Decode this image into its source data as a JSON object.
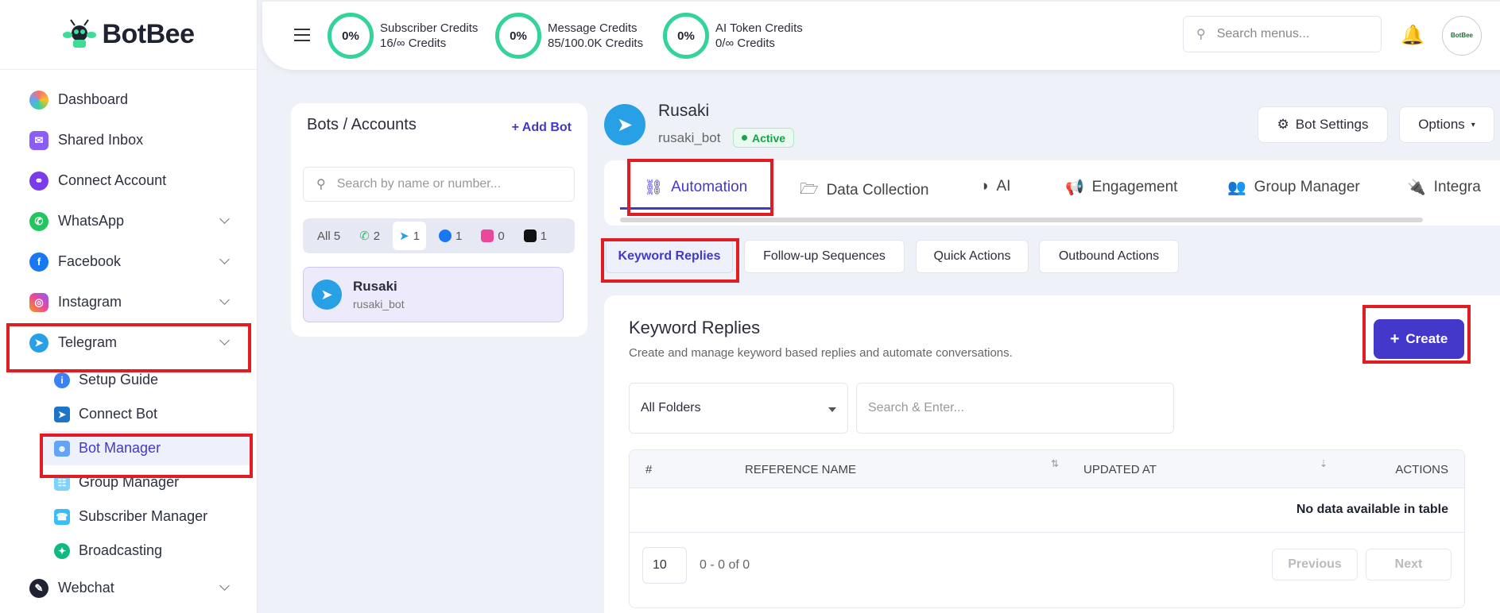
{
  "brand": {
    "name": "BotBee"
  },
  "sidebar": {
    "items": [
      {
        "label": "Dashboard",
        "icon": "dashboard-icon"
      },
      {
        "label": "Shared Inbox",
        "icon": "inbox-icon"
      },
      {
        "label": "Connect Account",
        "icon": "connect-icon"
      },
      {
        "label": "WhatsApp",
        "icon": "whatsapp-icon"
      },
      {
        "label": "Facebook",
        "icon": "facebook-icon"
      },
      {
        "label": "Instagram",
        "icon": "instagram-icon"
      },
      {
        "label": "Telegram",
        "icon": "telegram-icon"
      },
      {
        "label": "Webchat",
        "icon": "webchat-icon"
      }
    ],
    "telegram_sub": [
      {
        "label": "Setup Guide"
      },
      {
        "label": "Connect Bot"
      },
      {
        "label": "Bot Manager"
      },
      {
        "label": "Group Manager"
      },
      {
        "label": "Subscriber Manager"
      },
      {
        "label": "Broadcasting"
      }
    ]
  },
  "topbar": {
    "credits": [
      {
        "percent": "0%",
        "title": "Subscriber Credits",
        "value": "16/∞ Credits"
      },
      {
        "percent": "0%",
        "title": "Message Credits",
        "value": "85/100.0K Credits"
      },
      {
        "percent": "0%",
        "title": "AI Token Credits",
        "value": "0/∞ Credits"
      }
    ],
    "search_placeholder": "Search menus...",
    "avatar_text": "BotBee"
  },
  "bots_panel": {
    "title": "Bots / Accounts",
    "add_label": "+ Add Bot",
    "search_placeholder": "Search by name or number...",
    "filters": {
      "all": "All 5",
      "whatsapp": "2",
      "telegram": "1",
      "facebook": "1",
      "instagram": "0",
      "threads": "1"
    },
    "bot": {
      "name": "Rusaki",
      "username": "rusaki_bot"
    }
  },
  "bot_header": {
    "name": "Rusaki",
    "username": "rusaki_bot",
    "status": "Active",
    "settings_label": "Bot Settings",
    "options_label": "Options"
  },
  "tabs": [
    "Automation",
    "Data Collection",
    "AI",
    "Engagement",
    "Group Manager",
    "Integra"
  ],
  "subtabs": [
    "Keyword Replies",
    "Follow-up Sequences",
    "Quick Actions",
    "Outbound Actions"
  ],
  "keyword_replies": {
    "title": "Keyword Replies",
    "description": "Create and manage keyword based replies and automate conversations.",
    "create_label": "Create",
    "folder_selected": "All Folders",
    "search_placeholder": "Search & Enter...",
    "columns": [
      "#",
      "REFERENCE NAME",
      "UPDATED AT",
      "ACTIONS"
    ],
    "empty_text": "No data available in table",
    "page_size": "10",
    "range": "0 - 0 of 0",
    "prev_label": "Previous",
    "next_label": "Next"
  },
  "colors": {
    "accent": "#4338ca",
    "highlight": "#e11d23",
    "telegram": "#28a0e6",
    "ring": "#34d399"
  }
}
